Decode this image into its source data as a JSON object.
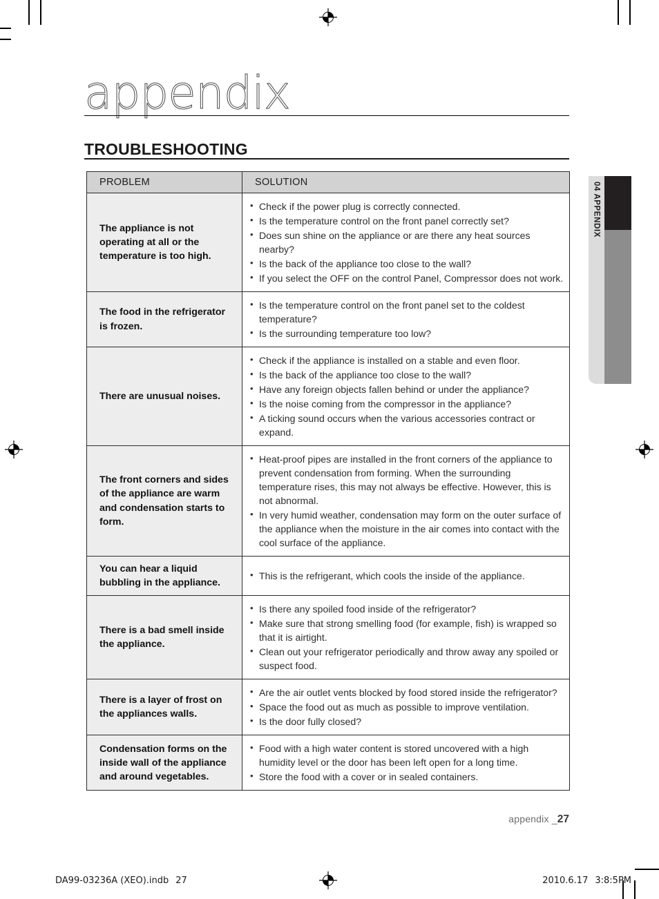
{
  "page": {
    "title": "appendix",
    "section_heading": "TROUBLESHOOTING",
    "folio_label": "appendix _",
    "folio_number": "27"
  },
  "thumb_tab": {
    "label": "04 APPENDIX",
    "colors": {
      "strip_light": "#dcdcdc",
      "strip_dark": "#231f20",
      "strip_gray": "#8d8d8d"
    }
  },
  "table": {
    "columns": [
      "PROBLEM",
      "SOLUTION"
    ],
    "rows": [
      {
        "problem": "The appliance is not operating at all or the temperature is too high.",
        "solutions": [
          "Check if the power plug is correctly connected.",
          "Is the temperature control on the front panel correctly set?",
          "Does sun shine on the appliance or are there any heat sources nearby?",
          "Is the back of the appliance too close to the wall?",
          "If you select the OFF on the control Panel, Compressor does not work."
        ]
      },
      {
        "problem": "The food in the refrigerator is frozen.",
        "solutions": [
          "Is the temperature control on the front panel set to the coldest temperature?",
          "Is the surrounding temperature too low?"
        ]
      },
      {
        "problem": "There are unusual noises.",
        "solutions": [
          "Check if the appliance is installed on a stable and even floor.",
          "Is the back of the appliance too close to the wall?",
          "Have any foreign objects fallen behind or under the appliance?",
          "Is the noise coming from the compressor in the appliance?",
          "A ticking sound occurs when the various accessories contract or expand."
        ]
      },
      {
        "problem": "The front corners and sides of the appliance are warm and condensation starts to form.",
        "solutions": [
          "Heat-proof pipes are installed in the front corners of the appliance to prevent condensation from forming. When the surrounding temperature rises, this may not always be effective. However, this is not abnormal.",
          "In very humid weather, condensation may form on the outer surface of the appliance when the moisture in the air comes into contact with the cool surface of the appliance."
        ]
      },
      {
        "problem": "You can hear a liquid bubbling in the appliance.",
        "solutions": [
          "This is the refrigerant, which cools the inside of the appliance."
        ]
      },
      {
        "problem": "There is a bad smell inside the appliance.",
        "solutions": [
          "Is there any spoiled food inside of the refrigerator?",
          "Make sure that strong smelling food (for example, fish) is wrapped so that it is airtight.",
          "Clean out your refrigerator periodically and throw away any spoiled or suspect food."
        ]
      },
      {
        "problem": "There is a layer of frost on the appliances walls.",
        "solutions": [
          "Are the air outlet vents blocked by food stored inside the refrigerator?",
          "Space the food out as much as possible to improve ventilation.",
          "Is the door fully closed?"
        ]
      },
      {
        "problem": "Condensation forms on the inside wall of the appliance and around vegetables.",
        "solutions": [
          "Food with a high water content is stored uncovered with a high humidity level or the door has been left open for a long time.",
          "Store the food with a cover or in sealed containers."
        ]
      }
    ]
  },
  "slug": {
    "file_name": "DA99-03236A (XEO).indb",
    "page_number": "27",
    "date": "2010.6.17",
    "time": "3:8:5",
    "meridiem": "PM"
  }
}
